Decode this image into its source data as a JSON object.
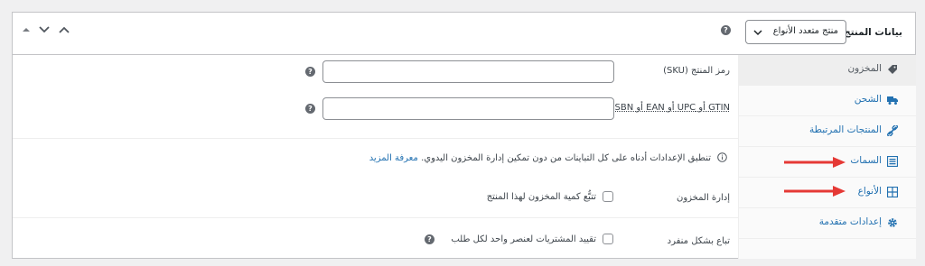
{
  "header": {
    "title": "بيانات المنتج —",
    "product_type": "منتج متعدد الأنواع"
  },
  "sidebar": {
    "items": [
      {
        "label": "المخزون",
        "icon": "tag-icon"
      },
      {
        "label": "الشحن",
        "icon": "truck-icon"
      },
      {
        "label": "المنتجات المرتبطة",
        "icon": "link-icon"
      },
      {
        "label": "السمات",
        "icon": "list-view-icon"
      },
      {
        "label": "الأنواع",
        "icon": "grid-icon"
      },
      {
        "label": "إعدادات متقدمة",
        "icon": "gear-icon"
      }
    ]
  },
  "inventory": {
    "sku_label": "رمز المنتج (SKU)",
    "gtin_label": "GTIN أو UPC أو EAN أو ISBN",
    "notice_text": "تنطبق الإعدادات أدناه على كل التباينات من دون تمكين إدارة المخزون اليدوي.",
    "notice_link": "معرفة المزيد",
    "manage_stock_label": "إدارة المخزون",
    "manage_stock_checkbox": "تتبُّع كمية المخزون لهذا المنتج",
    "sold_individually_label": "تباع بشكل منفرد",
    "sold_individually_checkbox": "تقييد المشتريات لعنصر واحد لكل طلب"
  },
  "colors": {
    "accent": "#2271b1",
    "arrow": "#e53935",
    "active_tab": "#eeeeee"
  }
}
